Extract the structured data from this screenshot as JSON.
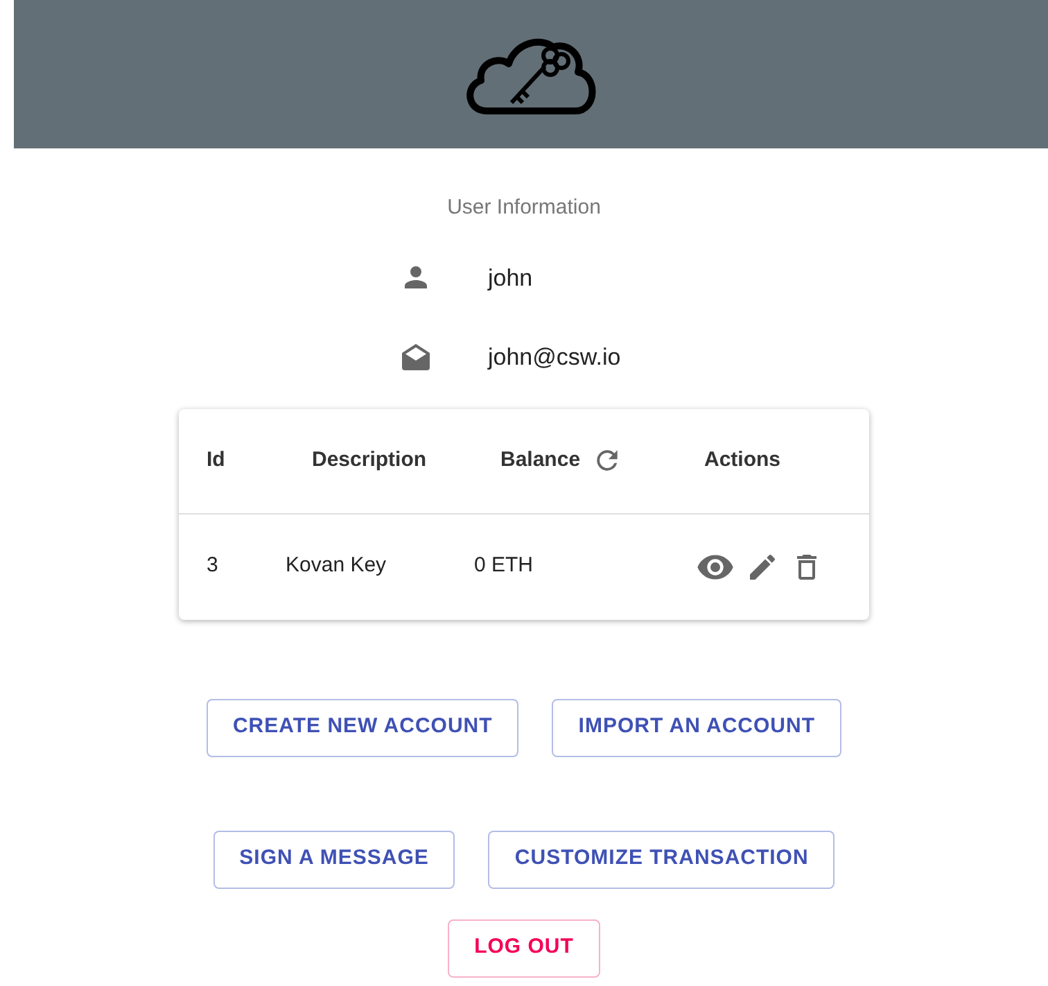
{
  "section_title": "User Information",
  "user": {
    "name": "john",
    "email": "john@csw.io"
  },
  "table": {
    "columns": [
      {
        "label": "Id",
        "kind": "plain"
      },
      {
        "label": "Description",
        "kind": "plain"
      },
      {
        "label": "Balance",
        "kind": "refresh"
      },
      {
        "label": "Actions",
        "kind": "plain"
      }
    ],
    "rows": [
      {
        "id": "3",
        "description": "Kovan Key",
        "balance": "0 ETH"
      }
    ]
  },
  "button_rows": [
    [
      {
        "label": "CREATE NEW ACCOUNT",
        "kind": "primary"
      },
      {
        "label": "IMPORT AN ACCOUNT",
        "kind": "primary"
      }
    ],
    [
      {
        "label": "SIGN A MESSAGE",
        "kind": "primary"
      },
      {
        "label": "CUSTOMIZE TRANSACTION",
        "kind": "primary"
      }
    ],
    [
      {
        "label": "LOG OUT",
        "kind": "danger"
      }
    ]
  ]
}
